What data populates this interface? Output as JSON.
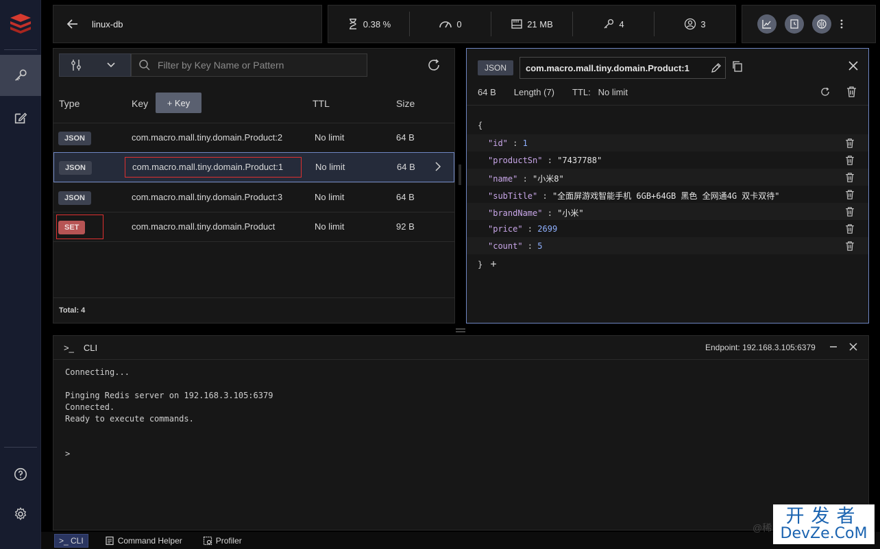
{
  "header": {
    "db_name": "linux-db",
    "stats": [
      {
        "icon": "cpu-hourglass-icon",
        "value": "0.38 %"
      },
      {
        "icon": "gauge-icon",
        "value": "0"
      },
      {
        "icon": "memory-icon",
        "value": "21 MB"
      },
      {
        "icon": "key-icon",
        "value": "4"
      },
      {
        "icon": "user-icon",
        "value": "3"
      }
    ]
  },
  "keylist": {
    "filter_placeholder": "Filter by Key Name or Pattern",
    "columns": {
      "type": "Type",
      "key": "Key",
      "ttl": "TTL",
      "size": "Size"
    },
    "add_key_label": "+ Key",
    "rows": [
      {
        "type": "JSON",
        "key": "com.macro.mall.tiny.domain.Product:2",
        "ttl": "No limit",
        "size": "64 B"
      },
      {
        "type": "JSON",
        "key": "com.macro.mall.tiny.domain.Product:1",
        "ttl": "No limit",
        "size": "64 B"
      },
      {
        "type": "JSON",
        "key": "com.macro.mall.tiny.domain.Product:3",
        "ttl": "No limit",
        "size": "64 B"
      },
      {
        "type": "SET",
        "key": "com.macro.mall.tiny.domain.Product",
        "ttl": "No limit",
        "size": "92 B"
      }
    ],
    "total": "Total: 4"
  },
  "detail": {
    "type": "JSON",
    "key_name": "com.macro.mall.tiny.domain.Product:1",
    "size": "64 B",
    "length": "Length (7)",
    "ttl_label": "TTL:",
    "ttl_value": "No limit",
    "json_open": "{",
    "json_close": "}",
    "add_symbol": "+",
    "fields": [
      {
        "key": "\"id\"",
        "sep": " : ",
        "value": "1",
        "kind": "num"
      },
      {
        "key": "\"productSn\"",
        "sep": " : ",
        "value": "\"7437788\"",
        "kind": "str"
      },
      {
        "key": "\"name\"",
        "sep": " : ",
        "value": "\"小米8\"",
        "kind": "str"
      },
      {
        "key": "\"subTitle\"",
        "sep": " : ",
        "value": "\"全面屏游戏智能手机 6GB+64GB 黑色 全网通4G 双卡双待\"",
        "kind": "str"
      },
      {
        "key": "\"brandName\"",
        "sep": " : ",
        "value": "\"小米\"",
        "kind": "str"
      },
      {
        "key": "\"price\"",
        "sep": " : ",
        "value": "2699",
        "kind": "num"
      },
      {
        "key": "\"count\"",
        "sep": " : ",
        "value": "5",
        "kind": "num"
      }
    ]
  },
  "cli": {
    "prompt_symbol": ">_",
    "title": "CLI",
    "endpoint_label": "Endpoint:",
    "endpoint": "192.168.3.105:6379",
    "lines": [
      "Connecting...",
      "",
      "Pinging Redis server on 192.168.3.105:6379",
      "Connected.",
      "Ready to execute commands."
    ],
    "input_prompt": ">"
  },
  "bottombar": {
    "cli_label": ">_ CLI",
    "helper_label": "Command Helper",
    "profiler_label": "Profiler"
  },
  "watermark": {
    "line1": "开发者",
    "line2": "DevZe.CoM",
    "at": "@稀"
  },
  "colors": {
    "accent": "#6f86c2",
    "set_badge": "#b75454",
    "highlight_box": "#e03030"
  }
}
